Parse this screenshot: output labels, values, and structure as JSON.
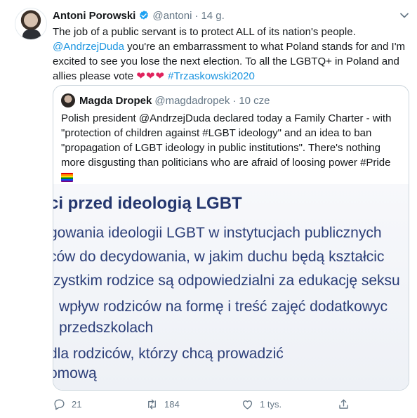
{
  "tweet": {
    "author_name": "Antoni Porowski",
    "author_handle": "@antoni",
    "separator": "·",
    "time": "14 g.",
    "text_line1": "The job of a public servant is to protect ALL of its nation's people.",
    "mention": "@AndrzejDuda",
    "text_line2_rest": " you're an embarrassment to what Poland stands for and I'm excited to see you lose the next election. To all the LGBTQ+ in Poland and allies please vote ",
    "hearts": "❤❤❤",
    "hashtag": " #Trzaskowski2020"
  },
  "quote": {
    "author_name": "Magda Dropek",
    "author_handle": "@magdadropek",
    "separator": "·",
    "time": "10 cze",
    "text": "Polish president @AndrzejDuda declared today a Family Charter - with \"protection of children against #LGBT ideology\" and an idea to ban \"propagation of LGBT ideology in public institutions\". There's nothing more disgusting than politicians who are afraid of loosing power #Pride",
    "image_lines": [
      "ci przed ideologią LGBT",
      "gowania ideologii LGBT w instytucjach publicznych",
      "ców do decydowania, w jakim duchu będą kształcic",
      "zystkim rodzice są odpowiedzialni za edukację seksu",
      "wpływ rodziców na formę i treść zajęć dodatkowyc",
      "przedszkolach",
      "dla rodziców, którzy chcą prowadzić",
      "omową"
    ]
  },
  "actions": {
    "reply_count": "21",
    "retweet_count": "184",
    "like_count": "1 tys."
  },
  "colors": {
    "link": "#1b95e0",
    "muted": "#657786",
    "heart": "#e0245e",
    "verified": "#1da1f2",
    "image_text": "#2b3e78"
  },
  "icons": {
    "verified": "verified-badge-icon",
    "more": "chevron-down-icon",
    "reply": "reply-icon",
    "retweet": "retweet-icon",
    "like": "heart-icon",
    "share": "share-icon"
  }
}
